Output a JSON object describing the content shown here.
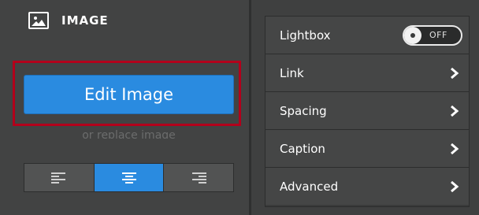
{
  "panel": {
    "title": "IMAGE",
    "edit_button": "Edit Image",
    "replace_text": "or replace image",
    "align_options": [
      "align-left",
      "align-center",
      "align-right"
    ],
    "align_selected": "align-center"
  },
  "settings": {
    "rows": [
      {
        "label": "Lightbox",
        "control": "toggle",
        "toggle_text": "OFF"
      },
      {
        "label": "Link",
        "control": "chevron"
      },
      {
        "label": "Spacing",
        "control": "chevron"
      },
      {
        "label": "Caption",
        "control": "chevron"
      },
      {
        "label": "Advanced",
        "control": "chevron"
      }
    ]
  },
  "colors": {
    "accent": "#2a8be0",
    "highlight_border": "#b3001b",
    "panel_bg": "#424343"
  }
}
